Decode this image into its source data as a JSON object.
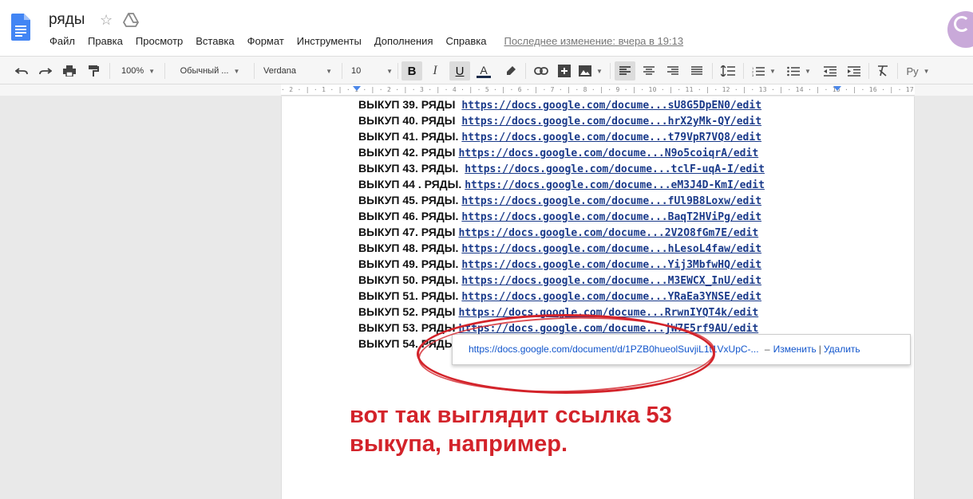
{
  "header": {
    "title": "ряды",
    "menu": [
      "Файл",
      "Правка",
      "Просмотр",
      "Вставка",
      "Формат",
      "Инструменты",
      "Дополнения",
      "Справка"
    ],
    "last_edit": "Последнее изменение: вчера в 19:13"
  },
  "toolbar": {
    "zoom": "100%",
    "style": "Обычный ...",
    "font": "Verdana",
    "size": "10",
    "lang": "Ру"
  },
  "ruler": "· 2 · | · 1 · |   · 1 · | · 2 · | · 3 · | · 4 · | · 5 · | · 6 · | · 7 · | · 8 · | · 9 · | · 10 · | · 11 · | · 12 · | · 13 · | · 14 · | · 15 · | · 16 · | · 17 · | · 18 ·",
  "document": {
    "lines": [
      {
        "label": "ВЫКУП 39. РЯДЫ ",
        "url": "https://docs.google.com/docume...sU8G5DpEN0/edit"
      },
      {
        "label": "ВЫКУП 40. РЯДЫ ",
        "url": "https://docs.google.com/docume...hrX2yMk-QY/edit"
      },
      {
        "label": "ВЫКУП 41. РЯДЫ.",
        "url": "https://docs.google.com/docume...t79VpR7VQ8/edit"
      },
      {
        "label": "ВЫКУП 42. РЯДЫ",
        "url": "https://docs.google.com/docume...N9o5coiqrA/edit"
      },
      {
        "label": "ВЫКУП 43. РЯДЫ. ",
        "url": "https://docs.google.com/docume...tclF-uqA-I/edit"
      },
      {
        "label": "ВЫКУП 44 . РЯДЫ.",
        "url": "https://docs.google.com/docume...eM3J4D-KmI/edit"
      },
      {
        "label": "ВЫКУП 45. РЯДЫ.",
        "url": "https://docs.google.com/docume...fUl9B8Loxw/edit"
      },
      {
        "label": "ВЫКУП 46. РЯДЫ.",
        "url": "https://docs.google.com/docume...BaqT2HViPg/edit"
      },
      {
        "label": "ВЫКУП 47. РЯДЫ",
        "url": "https://docs.google.com/docume...2V2O8fGm7E/edit"
      },
      {
        "label": "ВЫКУП 48. РЯДЫ.",
        "url": "https://docs.google.com/docume...hLesoL4faw/edit"
      },
      {
        "label": "ВЫКУП 49. РЯДЫ.",
        "url": "https://docs.google.com/docume...Yij3MbfwHQ/edit"
      },
      {
        "label": "ВЫКУП 50. РЯДЫ.",
        "url": "https://docs.google.com/docume...M3EWCX_InU/edit"
      },
      {
        "label": "ВЫКУП 51. РЯДЫ.",
        "url": "https://docs.google.com/docume...YRaEa3YNSE/edit"
      },
      {
        "label": "ВЫКУП 52. РЯДЫ",
        "url": "https://docs.google.com/docume...RrwnIYQT4k/edit"
      },
      {
        "label": "ВЫКУП 53. РЯДЫ",
        "url": "https://docs.google.com/docume...jW7F5rf9AU/edit"
      },
      {
        "label": "ВЫКУП 54. РЯДЫ",
        "url": ""
      }
    ]
  },
  "popup": {
    "link": "https://docs.google.com/document/d/1PZB0hueolSuvjiL1t1VxUpC-...",
    "dash": "–",
    "change": "Изменить",
    "sep": "|",
    "delete": "Удалить"
  },
  "annotation": {
    "line1": "вот так выглядит ссылка 53",
    "line2": "выкупа, например."
  },
  "colors": {
    "annotation": "#d3232a",
    "link": "#1155cc"
  }
}
